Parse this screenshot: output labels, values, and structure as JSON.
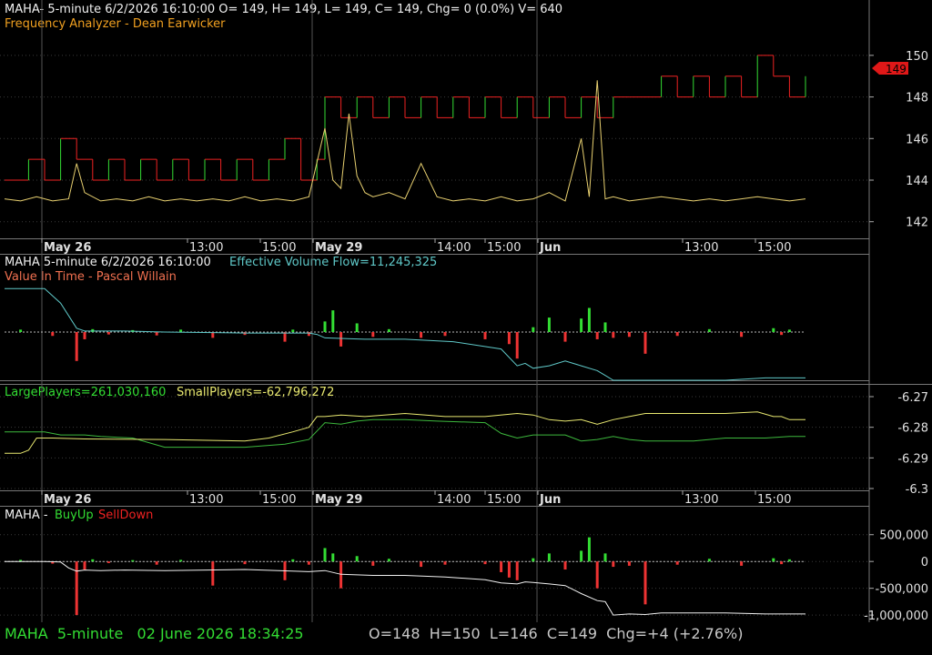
{
  "symbol": "MAHA",
  "colors": {
    "up": "#33dd33",
    "down": "#ee2222",
    "yellow": "#e8d070",
    "cyan": "#5fc8c8",
    "white": "#f0f0f0",
    "orange": "#f0a020",
    "label_gray": "#c8c8c8",
    "grid": "#3a3a3a",
    "separator": "#777777",
    "price_tag": "#e01818"
  },
  "panel1": {
    "header": "MAHA- 5-minute 6/2/2026 16:10:00 O= 149, H= 149, L= 149, C= 149, Chg= 0 (0.0%) V= 640",
    "subheader": "Frequency Analyzer - Dean Earwicker",
    "last_price": "149"
  },
  "panel2": {
    "header_prefix": "MAHA 5-minute  6/2/2026 16:10:00",
    "header_evf": "Effective Volume Flow=11,245,325",
    "subheader": "Value In Time - Pascal Willain"
  },
  "panel3": {
    "large_players": "LargePlayers=261,030,160",
    "small_players": "SmallPlayers=-62,796,272"
  },
  "panel4": {
    "prefix": "MAHA - ",
    "buy_up": "BuyUp",
    "sell_down": "SellDown"
  },
  "status_bar": {
    "left": "MAHA  5-minute   02 June 2026 18:34:25",
    "right": "O=148  H=150  L=146  C=149  Chg=+4 (+2.76%)"
  },
  "time_axis": {
    "labels": [
      "May 26",
      "13:00",
      "15:00",
      "May 29",
      "14:00",
      "15:00",
      "Jun",
      "13:00",
      "15:00"
    ],
    "bold": [
      true,
      false,
      false,
      true,
      false,
      false,
      true,
      false,
      false
    ],
    "day_separator_indices": [
      0,
      3,
      6
    ]
  },
  "chart_data": [
    {
      "type": "line",
      "name": "price",
      "x_range": [
        0,
        100
      ],
      "ylim": [
        141.2,
        151.0
      ],
      "y_ticks": [
        142,
        144,
        146,
        148,
        150
      ],
      "grid": true,
      "series": [
        {
          "name": "close",
          "color": "#e02020",
          "x": [
            0,
            3,
            5,
            7,
            9,
            11,
            13,
            15,
            17,
            19,
            21,
            23,
            25,
            27,
            29,
            31,
            33,
            35,
            37,
            39,
            40,
            42,
            44,
            46,
            48,
            50,
            52,
            54,
            56,
            58,
            60,
            62,
            64,
            66,
            68,
            70,
            72,
            74,
            76,
            78,
            80,
            82,
            84,
            86,
            88,
            90,
            92,
            94,
            96,
            98,
            100
          ],
          "y": [
            144,
            145,
            144,
            146,
            145,
            144,
            145,
            144,
            145,
            144,
            145,
            144,
            145,
            144,
            145,
            144,
            145,
            146,
            144,
            145,
            148,
            147,
            148,
            147,
            148,
            147,
            148,
            147,
            148,
            147,
            148,
            147,
            148,
            147,
            148,
            147,
            148,
            147,
            148,
            148,
            148,
            149,
            148,
            149,
            148,
            149,
            148,
            150,
            149,
            148,
            149
          ]
        },
        {
          "name": "frequency",
          "color": "#e8d070",
          "x": [
            0,
            2,
            4,
            6,
            8,
            9,
            10,
            12,
            14,
            16,
            18,
            20,
            22,
            24,
            26,
            28,
            30,
            32,
            34,
            36,
            38,
            40,
            41,
            42,
            43,
            44,
            45,
            46,
            48,
            50,
            52,
            54,
            56,
            58,
            60,
            62,
            64,
            66,
            68,
            70,
            72,
            73,
            74,
            75,
            76,
            78,
            80,
            82,
            84,
            86,
            88,
            90,
            92,
            94,
            96,
            98,
            100
          ],
          "y": [
            143.1,
            143.0,
            143.2,
            143.0,
            143.1,
            144.8,
            143.4,
            143.0,
            143.1,
            143.0,
            143.2,
            143.0,
            143.1,
            143.0,
            143.1,
            143.0,
            143.2,
            143.0,
            143.1,
            143.0,
            143.2,
            146.5,
            144.0,
            143.6,
            147.2,
            144.2,
            143.4,
            143.2,
            143.4,
            143.1,
            144.8,
            143.2,
            143.0,
            143.1,
            143.0,
            143.2,
            143.0,
            143.1,
            143.4,
            143.0,
            146.0,
            143.2,
            148.8,
            143.1,
            143.2,
            143.0,
            143.1,
            143.2,
            143.1,
            143.0,
            143.1,
            143.0,
            143.1,
            143.2,
            143.1,
            143.0,
            143.1
          ]
        }
      ]
    },
    {
      "type": "bar",
      "name": "effective-volume-flow",
      "x_range": [
        0,
        100
      ],
      "ylim": [
        -1,
        1
      ],
      "series": [
        {
          "name": "evf_bars",
          "up_color": "#33dd33",
          "down_color": "#ee3333",
          "x": [
            2,
            6,
            9,
            10,
            11,
            13,
            16,
            19,
            22,
            26,
            30,
            35,
            36,
            38,
            40,
            41,
            42,
            44,
            46,
            48,
            52,
            55,
            60,
            63,
            64,
            66,
            68,
            70,
            72,
            73,
            74,
            75,
            76,
            78,
            80,
            84,
            88,
            92,
            96,
            97,
            98
          ],
          "values": [
            0.05,
            -0.08,
            -0.6,
            -0.15,
            0.06,
            -0.05,
            0.04,
            -0.07,
            0.05,
            -0.12,
            -0.06,
            -0.2,
            0.05,
            -0.08,
            0.22,
            0.45,
            -0.3,
            0.18,
            -0.1,
            0.06,
            -0.12,
            -0.08,
            -0.15,
            -0.25,
            -0.55,
            0.1,
            0.3,
            -0.2,
            0.28,
            0.5,
            -0.15,
            0.2,
            -0.12,
            -0.1,
            -0.45,
            -0.08,
            0.06,
            -0.1,
            0.08,
            -0.06,
            0.05
          ]
        },
        {
          "name": "evf_line",
          "color": "#5fc8c8",
          "x": [
            0,
            5,
            7,
            9,
            10,
            15,
            20,
            30,
            38,
            39,
            40,
            45,
            50,
            56,
            62,
            64,
            65,
            66,
            68,
            70,
            72,
            74,
            75,
            76,
            78,
            80,
            90,
            95,
            100
          ],
          "y": [
            0.9,
            0.9,
            0.6,
            0.08,
            0.02,
            0.02,
            0.0,
            -0.02,
            -0.02,
            -0.05,
            -0.12,
            -0.15,
            -0.15,
            -0.2,
            -0.35,
            -0.7,
            -0.65,
            -0.75,
            -0.7,
            -0.6,
            -0.7,
            -0.8,
            -0.9,
            -1.0,
            -1.0,
            -1.0,
            -1.0,
            -0.95,
            -0.95
          ]
        }
      ]
    },
    {
      "type": "line",
      "name": "players",
      "x_range": [
        0,
        100
      ],
      "ylim": [
        -6.3,
        -6.27
      ],
      "y_ticks": [
        -6.27,
        -6.28,
        -6.29,
        -6.3
      ],
      "grid": true,
      "series": [
        {
          "name": "LargePlayers",
          "color": "#3db83d",
          "x": [
            0,
            5,
            7,
            10,
            12,
            16,
            20,
            30,
            35,
            38,
            40,
            42,
            44,
            46,
            50,
            54,
            60,
            62,
            64,
            66,
            70,
            72,
            74,
            76,
            78,
            80,
            86,
            90,
            95,
            98,
            100
          ],
          "y": [
            -6.2815,
            -6.2815,
            -6.2825,
            -6.2825,
            -6.283,
            -6.2835,
            -6.2865,
            -6.2865,
            -6.2855,
            -6.284,
            -6.2785,
            -6.279,
            -6.278,
            -6.2775,
            -6.2775,
            -6.278,
            -6.2785,
            -6.282,
            -6.2835,
            -6.2825,
            -6.2825,
            -6.2845,
            -6.284,
            -6.283,
            -6.284,
            -6.2845,
            -6.2845,
            -6.2835,
            -6.2835,
            -6.283,
            -6.283
          ]
        },
        {
          "name": "SmallPlayers",
          "color": "#e8e870",
          "x": [
            0,
            2,
            3,
            4,
            6,
            10,
            20,
            30,
            33,
            36,
            38,
            39,
            40,
            42,
            45,
            50,
            55,
            60,
            64,
            66,
            68,
            70,
            72,
            74,
            76,
            78,
            80,
            84,
            90,
            94,
            96,
            97,
            98,
            100
          ],
          "y": [
            -6.2885,
            -6.2885,
            -6.2875,
            -6.2835,
            -6.2835,
            -6.2838,
            -6.284,
            -6.2845,
            -6.2835,
            -6.2815,
            -6.28,
            -6.2765,
            -6.2765,
            -6.276,
            -6.2765,
            -6.2755,
            -6.2765,
            -6.2765,
            -6.2755,
            -6.276,
            -6.2775,
            -6.278,
            -6.2775,
            -6.279,
            -6.2775,
            -6.2765,
            -6.2755,
            -6.2755,
            -6.2755,
            -6.275,
            -6.2765,
            -6.2765,
            -6.2775,
            -6.2775
          ]
        }
      ]
    },
    {
      "type": "bar",
      "name": "buyup-selldown",
      "x_range": [
        0,
        100
      ],
      "ylim": [
        -1100000,
        750000
      ],
      "y_ticks": [
        500000,
        0,
        -500000,
        -1000000
      ],
      "y_tick_labels": [
        "500,000",
        "0",
        "-500,000",
        "-1,000,000"
      ],
      "series": [
        {
          "name": "bars",
          "up_color": "#33dd33",
          "down_color": "#ee3333",
          "x": [
            2,
            6,
            9,
            10,
            11,
            13,
            16,
            19,
            22,
            26,
            30,
            35,
            36,
            38,
            40,
            41,
            42,
            44,
            46,
            48,
            52,
            55,
            60,
            62,
            63,
            64,
            66,
            68,
            70,
            72,
            73,
            74,
            75,
            76,
            78,
            80,
            84,
            88,
            92,
            96,
            97,
            98
          ],
          "values": [
            30000,
            -40000,
            -1000000,
            -150000,
            40000,
            -30000,
            25000,
            -60000,
            30000,
            -450000,
            -50000,
            -350000,
            40000,
            -60000,
            250000,
            150000,
            -500000,
            100000,
            -80000,
            50000,
            -100000,
            -60000,
            -50000,
            -200000,
            -300000,
            -350000,
            60000,
            150000,
            -150000,
            200000,
            450000,
            -500000,
            150000,
            -100000,
            -80000,
            -800000,
            -60000,
            50000,
            -80000,
            60000,
            -50000,
            40000
          ]
        },
        {
          "name": "line",
          "color": "#f0f0f0",
          "x": [
            0,
            5,
            7,
            8,
            9,
            10,
            12,
            15,
            20,
            30,
            38,
            40,
            42,
            44,
            46,
            50,
            55,
            60,
            62,
            64,
            65,
            66,
            68,
            70,
            72,
            74,
            75,
            76,
            78,
            80,
            82,
            90,
            95,
            98,
            100
          ],
          "y": [
            0,
            0,
            -10000,
            -120000,
            -180000,
            -160000,
            -170000,
            -160000,
            -170000,
            -150000,
            -190000,
            -170000,
            -240000,
            -250000,
            -260000,
            -260000,
            -290000,
            -340000,
            -400000,
            -420000,
            -380000,
            -390000,
            -420000,
            -450000,
            -600000,
            -730000,
            -750000,
            -1000000,
            -980000,
            -990000,
            -960000,
            -960000,
            -980000,
            -980000,
            -980000
          ]
        }
      ]
    }
  ]
}
